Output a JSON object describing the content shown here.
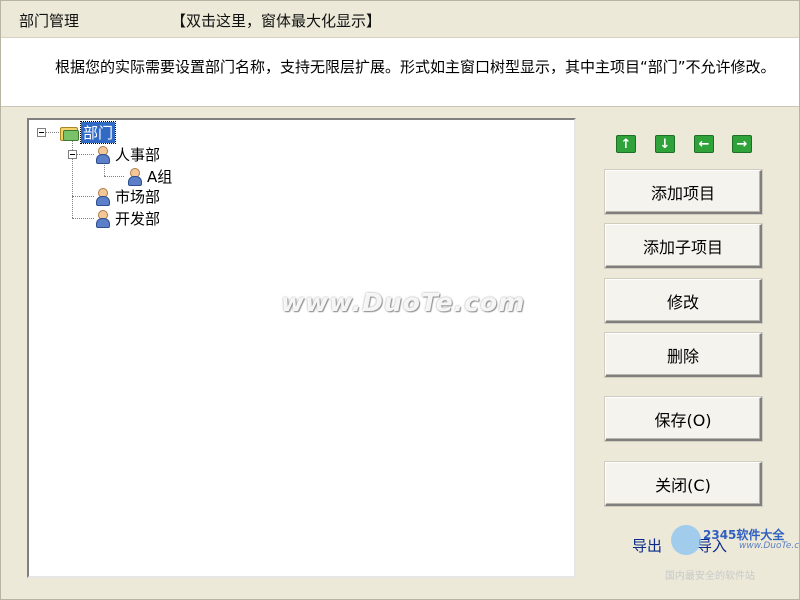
{
  "window": {
    "title": "部门管理",
    "maximize_hint": "【双击这里，窗体最大化显示】"
  },
  "description": "根据您的实际需要设置部门名称，支持无限层扩展。形式如主窗口树型显示，其中主项目“部门”不允许修改。",
  "tree": {
    "root": {
      "label": "部门",
      "icon": "folder-icon",
      "expanded": true,
      "selected": true
    },
    "children": [
      {
        "label": "人事部",
        "icon": "person-icon",
        "expanded": true,
        "children": [
          {
            "label": "A组",
            "icon": "person-icon"
          }
        ]
      },
      {
        "label": "市场部",
        "icon": "person-icon"
      },
      {
        "label": "开发部",
        "icon": "person-icon"
      }
    ]
  },
  "arrows": [
    {
      "name": "move-up",
      "glyph": "↑",
      "icon": "arrow-up-icon"
    },
    {
      "name": "move-down",
      "glyph": "↓",
      "icon": "arrow-down-icon"
    },
    {
      "name": "move-left",
      "glyph": "←",
      "icon": "arrow-left-icon"
    },
    {
      "name": "move-right",
      "glyph": "→",
      "icon": "arrow-right-icon"
    }
  ],
  "buttons": {
    "add_item": "添加项目",
    "add_subitem": "添加子项目",
    "modify": "修改",
    "delete": "删除",
    "save": "保存(O)",
    "close": "关闭(C)"
  },
  "links": {
    "export": "导出",
    "import": "导入"
  },
  "watermark": {
    "text": "www.DuoTe.com",
    "corner_logo": "2345软件大全",
    "corner_url": "www.DuoTe.com",
    "corner_caption": "国内最安全的软件站"
  },
  "colors": {
    "window_bg": "#ece9d8",
    "selection": "#316ac5",
    "arrow_green": "#2fa23a",
    "link": "#0a2a8a"
  }
}
